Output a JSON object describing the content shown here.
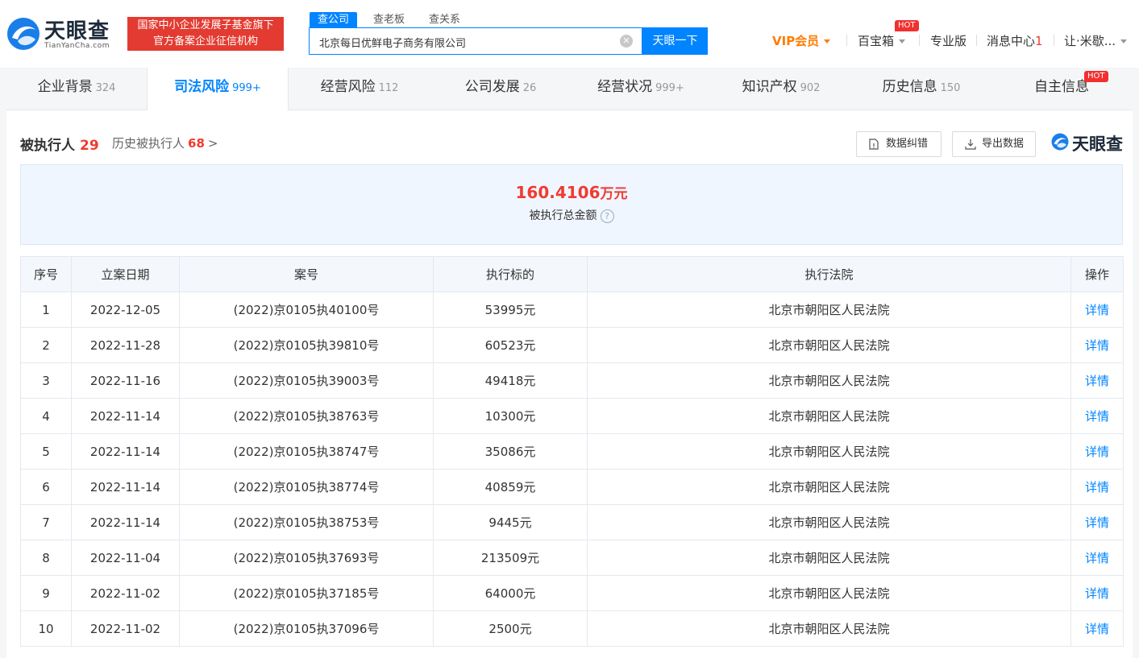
{
  "header": {
    "logo_text": "天眼查",
    "logo_sub": "TianYanCha.com",
    "gov_badge": [
      "国家中小企业发展子基金旗下",
      "官方备案企业征信机构"
    ],
    "search_tabs": [
      "查公司",
      "查老板",
      "查关系"
    ],
    "search_value": "北京每日优鲜电子商务有限公司",
    "search_button": "天眼一下",
    "nav": {
      "vip": "VIP会员",
      "baibaoxiang": "百宝箱",
      "hot": "HOT",
      "pro": "专业版",
      "messages": "消息中心",
      "message_count": "1",
      "user": "让·米歇..."
    }
  },
  "categories": [
    {
      "label": "企业背景",
      "count": "324"
    },
    {
      "label": "司法风险",
      "count": "999+"
    },
    {
      "label": "经营风险",
      "count": "112"
    },
    {
      "label": "公司发展",
      "count": "26"
    },
    {
      "label": "经营状况",
      "count": "999+"
    },
    {
      "label": "知识产权",
      "count": "902"
    },
    {
      "label": "历史信息",
      "count": "150"
    },
    {
      "label": "自主信息",
      "count": "",
      "badge": "HOT"
    }
  ],
  "section": {
    "title": "被执行人",
    "count": "29",
    "history_label": "历史被执行人",
    "history_count": "68",
    "history_arrow": ">",
    "correct_button": "数据纠错",
    "export_button": "导出数据",
    "brand": "天眼查"
  },
  "summary": {
    "amount": "160.4106",
    "unit": "万元",
    "label": "被执行总金额",
    "help": "?"
  },
  "table": {
    "headers": [
      "序号",
      "立案日期",
      "案号",
      "执行标的",
      "执行法院",
      "操作"
    ],
    "rows": [
      [
        "1",
        "2022-12-05",
        "(2022)京0105执40100号",
        "53995元",
        "北京市朝阳区人民法院",
        "详情"
      ],
      [
        "2",
        "2022-11-28",
        "(2022)京0105执39810号",
        "60523元",
        "北京市朝阳区人民法院",
        "详情"
      ],
      [
        "3",
        "2022-11-16",
        "(2022)京0105执39003号",
        "49418元",
        "北京市朝阳区人民法院",
        "详情"
      ],
      [
        "4",
        "2022-11-14",
        "(2022)京0105执38763号",
        "10300元",
        "北京市朝阳区人民法院",
        "详情"
      ],
      [
        "5",
        "2022-11-14",
        "(2022)京0105执38747号",
        "35086元",
        "北京市朝阳区人民法院",
        "详情"
      ],
      [
        "6",
        "2022-11-14",
        "(2022)京0105执38774号",
        "40859元",
        "北京市朝阳区人民法院",
        "详情"
      ],
      [
        "7",
        "2022-11-14",
        "(2022)京0105执38753号",
        "9445元",
        "北京市朝阳区人民法院",
        "详情"
      ],
      [
        "8",
        "2022-11-04",
        "(2022)京0105执37693号",
        "213509元",
        "北京市朝阳区人民法院",
        "详情"
      ],
      [
        "9",
        "2022-11-02",
        "(2022)京0105执37185号",
        "64000元",
        "北京市朝阳区人民法院",
        "详情"
      ],
      [
        "10",
        "2022-11-02",
        "(2022)京0105执37096号",
        "2500元",
        "北京市朝阳区人民法院",
        "详情"
      ]
    ]
  },
  "colors": {
    "accent": "#0084ff",
    "danger": "#f03b2f",
    "vip": "#ff7c00",
    "badge_red": "#e33b31"
  }
}
